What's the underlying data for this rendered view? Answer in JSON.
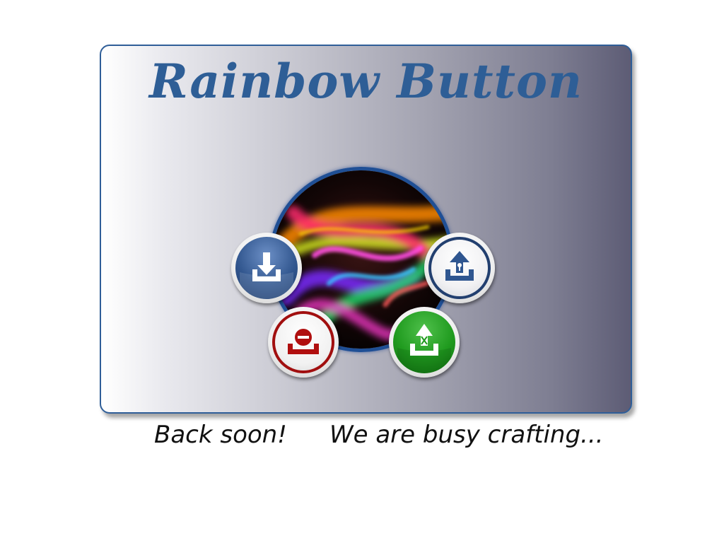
{
  "title": "Rainbow Button",
  "buttons": [
    {
      "name": "download-button",
      "icon": "download-icon",
      "color": "#2f5690"
    },
    {
      "name": "upload-button",
      "icon": "upload-icon",
      "color": "#223f6f"
    },
    {
      "name": "remove-button",
      "icon": "remove-icon",
      "color": "#a10f0f"
    },
    {
      "name": "publish-button",
      "icon": "publish-icon",
      "color": "#1f9a1e"
    }
  ],
  "footer": {
    "left_text": "Back soon!",
    "right_text": "We are busy crafting..."
  },
  "colors": {
    "title": "#2e5e96",
    "card_border": "#2f5e98"
  }
}
